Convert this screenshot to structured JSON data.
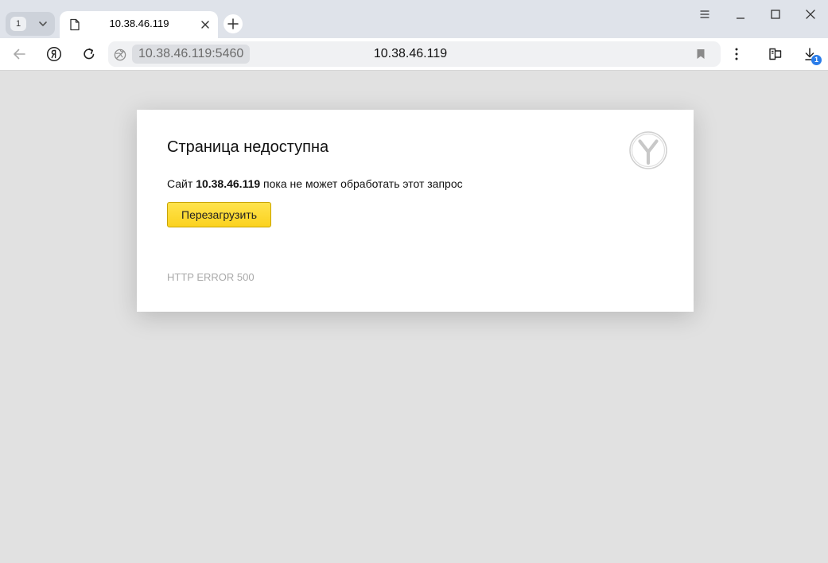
{
  "tab_strip": {
    "tab_count": "1",
    "active_tab": {
      "title": "10.38.46.119"
    }
  },
  "toolbar": {
    "address_host": "10.38.46.119:5460",
    "page_title": "10.38.46.119",
    "downloads_count": "1"
  },
  "error_page": {
    "title": "Страница недоступна",
    "message_prefix": "Сайт ",
    "message_host": "10.38.46.119",
    "message_suffix": " пока не может обработать этот запрос",
    "reload_label": "Перезагрузить",
    "error_code": "HTTP ERROR 500"
  },
  "icons": {
    "tab_strip": [
      "tab-list-chevron-icon",
      "page-icon",
      "close-icon",
      "plus-icon"
    ],
    "window": [
      "menu-icon",
      "minimize-icon",
      "maximize-icon",
      "close-window-icon"
    ],
    "toolbar": [
      "back-arrow-icon",
      "yandex-logo-icon",
      "reload-icon",
      "site-info-icon",
      "bookmark-icon",
      "more-vertical-icon",
      "sidebar-panel-icon",
      "download-icon"
    ],
    "content": [
      "yandex-browser-logo-icon"
    ]
  },
  "colors": {
    "tab_strip_bg": "#dfe3ea",
    "page_bg": "#e1e1e1",
    "reload_button": "#fbd21f",
    "badge": "#2b7de9",
    "error_code_text": "#a9a9a9"
  }
}
